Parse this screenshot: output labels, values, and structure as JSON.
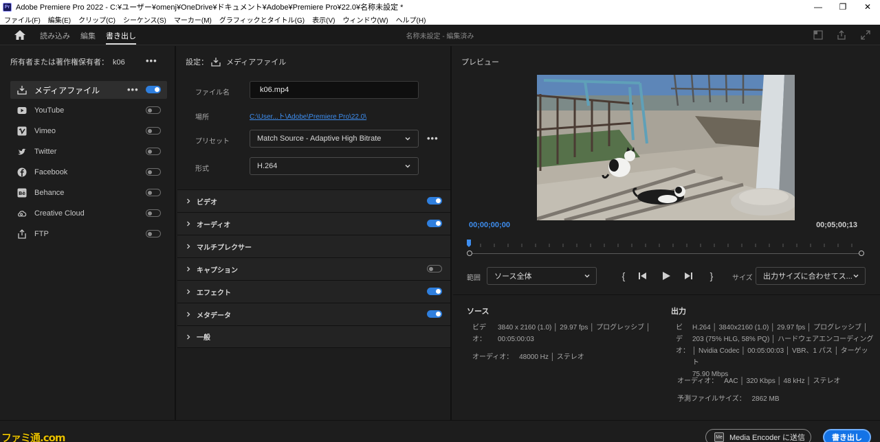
{
  "window": {
    "title": "Adobe Premiere Pro 2022 - C:¥ユーザー¥omenj¥OneDrive¥ドキュメント¥Adobe¥Premiere Pro¥22.0¥名称未設定 *",
    "logo": "Pr",
    "minimize": "—",
    "maximize": "❐",
    "close": "✕"
  },
  "menu": [
    "ファイル(F)",
    "編集(E)",
    "クリップ(C)",
    "シーケンス(S)",
    "マーカー(M)",
    "グラフィックとタイトル(G)",
    "表示(V)",
    "ウィンドウ(W)",
    "ヘルプ(H)"
  ],
  "header": {
    "tabs": [
      "読み込み",
      "編集",
      "書き出し"
    ],
    "active_tab": "書き出し",
    "project_status": "名称未設定 - 編集済み"
  },
  "left": {
    "owner_label": "所有者または著作権保有者：",
    "owner_name": "k06",
    "more": "•••",
    "destinations": [
      {
        "label": "メディアファイル",
        "icon": "download-icon",
        "on": true,
        "active": true
      },
      {
        "label": "YouTube",
        "icon": "youtube-icon",
        "on": false
      },
      {
        "label": "Vimeo",
        "icon": "vimeo-icon",
        "on": false
      },
      {
        "label": "Twitter",
        "icon": "twitter-icon",
        "on": false
      },
      {
        "label": "Facebook",
        "icon": "facebook-icon",
        "on": false
      },
      {
        "label": "Behance",
        "icon": "behance-icon",
        "on": false
      },
      {
        "label": "Creative Cloud",
        "icon": "creative-cloud-icon",
        "on": false
      },
      {
        "label": "FTP",
        "icon": "ftp-icon",
        "on": false
      }
    ]
  },
  "settings": {
    "heading": "設定：",
    "heading_target": "メディアファイル",
    "filename_label": "ファイル名",
    "filename_value": "k06.mp4",
    "location_label": "場所",
    "location_value": "C:\\User...ト\\Adobe\\Premiere Pro\\22.0\\",
    "preset_label": "プリセット",
    "preset_value": "Match Source - Adaptive High Bitrate",
    "format_label": "形式",
    "format_value": "H.264",
    "more": "•••",
    "sections": [
      {
        "label": "ビデオ",
        "toggle": "on"
      },
      {
        "label": "オーディオ",
        "toggle": "on"
      },
      {
        "label": "マルチプレクサー",
        "toggle": "none"
      },
      {
        "label": "キャプション",
        "toggle": "off"
      },
      {
        "label": "エフェクト",
        "toggle": "on"
      },
      {
        "label": "メタデータ",
        "toggle": "on"
      },
      {
        "label": "一般",
        "toggle": "none"
      }
    ]
  },
  "preview": {
    "title": "プレビュー",
    "timecode_start": "00;00;00;00",
    "timecode_end": "00;05;00;13",
    "range_label": "範囲",
    "range_value": "ソース全体",
    "size_label": "サイズ",
    "size_value": "出力サイズに合わせてス...",
    "mark_in": "{",
    "mark_out": "}"
  },
  "source": {
    "heading": "ソース",
    "video_key_1": "ビデ",
    "video_key_2": "オ：",
    "video_line1": "3840 x 2160 (1.0) │ 29.97 fps │ プログレッシブ │",
    "video_line2": "00:05:00:03",
    "audio_key": "オーディオ：",
    "audio_value": "48000 Hz │ ステレオ"
  },
  "output": {
    "heading": "出力",
    "video_key_1": "ビ",
    "video_key_2": "デ",
    "video_key_3": "オ：",
    "video_line1": "H.264 │ 3840x2160 (1.0) │ 29.97 fps │ プログレッシブ │",
    "video_line2": "203 (75% HLG, 58% PQ) │ ハードウェアエンコーディング",
    "video_line3": "│ Nvidia Codec │ 00:05:00:03 │ VBR、1 パス │ ターゲット",
    "video_line4": "75.90 Mbps",
    "audio_key": "オーディオ：",
    "audio_value": "AAC │ 320 Kbps │ 48 kHz │ ステレオ",
    "size_key": "予測ファイルサイズ：",
    "size_value": "2862 MB"
  },
  "footer": {
    "watermark": "ファミ通.com",
    "encoder_icon": "Me",
    "encoder_button": "Media Encoder に送信",
    "export_button": "書き出し"
  }
}
